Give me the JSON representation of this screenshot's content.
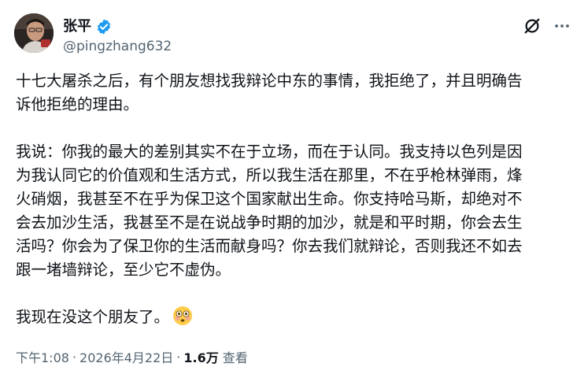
{
  "author": {
    "display_name": "张平",
    "handle": "@pingzhang632",
    "verified": true
  },
  "actions": {
    "grok_icon": "slashed-circle-icon",
    "more_icon": "ellipsis-icon"
  },
  "post": {
    "paragraphs": [
      [
        "十七大屠杀之后，有个朋友想找我辩论中东的事情，我拒绝了，并且明确告",
        "诉他拒绝的理由。"
      ],
      [
        "我说：你我的最大的差别其实不在于立场，而在于认同。我支持以色列是因",
        "为我认同它的价值观和生活方式，所以我生活在那里，不在乎枪林弹雨，烽",
        "火硝烟，我甚至不在乎为保卫这个国家献出生命。你支持哈马斯，却绝对不",
        "会去加沙生活，我甚至不是在说战争时期的加沙，就是和平时期，你会去生",
        "活吗？你会为了保卫你的生活而献身吗？你去我们就辩论，否则我还不如去",
        "跟一堵墙辩论，至少它不虚伪。"
      ],
      [
        "我现在没这个朋友了。"
      ]
    ],
    "emoji": "flushed-face-emoji"
  },
  "meta": {
    "time": "下午1:08",
    "separator": "·",
    "date": "2026年4月22日",
    "views": "1.6万",
    "views_label": "查看"
  },
  "colors": {
    "text": "#0f1419",
    "secondary": "#536471",
    "verified_blue": "#1d9bf0"
  }
}
